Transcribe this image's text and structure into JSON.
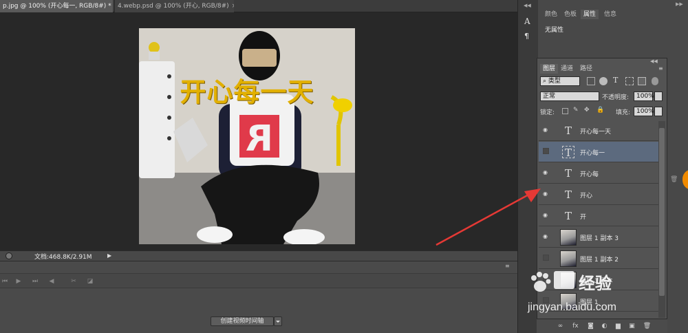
{
  "document_tabs": [
    {
      "label": "p.jpg @ 100% (开心每一, RGB/8#) *",
      "close": "×"
    },
    {
      "label": "4.webp.psd @ 100% (开心, RGB/8#)",
      "close": "×"
    }
  ],
  "canvas": {
    "overlay_text": "开心每一天"
  },
  "status": {
    "doc_label": "文档:468.8K/2.91M"
  },
  "timeline": {
    "create_button": "创建视频时间轴"
  },
  "right_panel": {
    "tabs": [
      "颜色",
      "色板",
      "属性",
      "信息"
    ],
    "active_tab_index": 2,
    "properties_text": "无属性",
    "char_glyph": "A",
    "para_glyph": "¶"
  },
  "layers_panel": {
    "tabs": [
      "图层",
      "通道",
      "路径"
    ],
    "filter_type": "类型",
    "blend_mode": "正常",
    "opacity_label": "不透明度:",
    "opacity_value": "100%",
    "lock_label": "锁定:",
    "fill_label": "填充:",
    "fill_value": "100%",
    "text_glyph": "T",
    "layers": [
      {
        "name": "开心每一天",
        "kind": "text",
        "visible": true,
        "selected": false
      },
      {
        "name": "开心每一",
        "kind": "text",
        "visible": false,
        "selected": true
      },
      {
        "name": "开心每",
        "kind": "text",
        "visible": true,
        "selected": false
      },
      {
        "name": "开心",
        "kind": "text",
        "visible": true,
        "selected": false
      },
      {
        "name": "开",
        "kind": "text",
        "visible": true,
        "selected": false
      },
      {
        "name": "图层 1 副本 3",
        "kind": "image",
        "visible": true,
        "selected": false
      },
      {
        "name": "图层 1 副本 2",
        "kind": "image",
        "visible": false,
        "selected": false
      },
      {
        "name": "图层 1 副本",
        "kind": "image",
        "visible": false,
        "selected": false
      },
      {
        "name": "图层 1",
        "kind": "image",
        "visible": false,
        "selected": false
      }
    ]
  },
  "watermark": {
    "brand": "经验",
    "url": "jingyan.baidu.com"
  },
  "colors": {
    "accent_red": "#e53935",
    "overlay_gold": "#e2b000"
  }
}
